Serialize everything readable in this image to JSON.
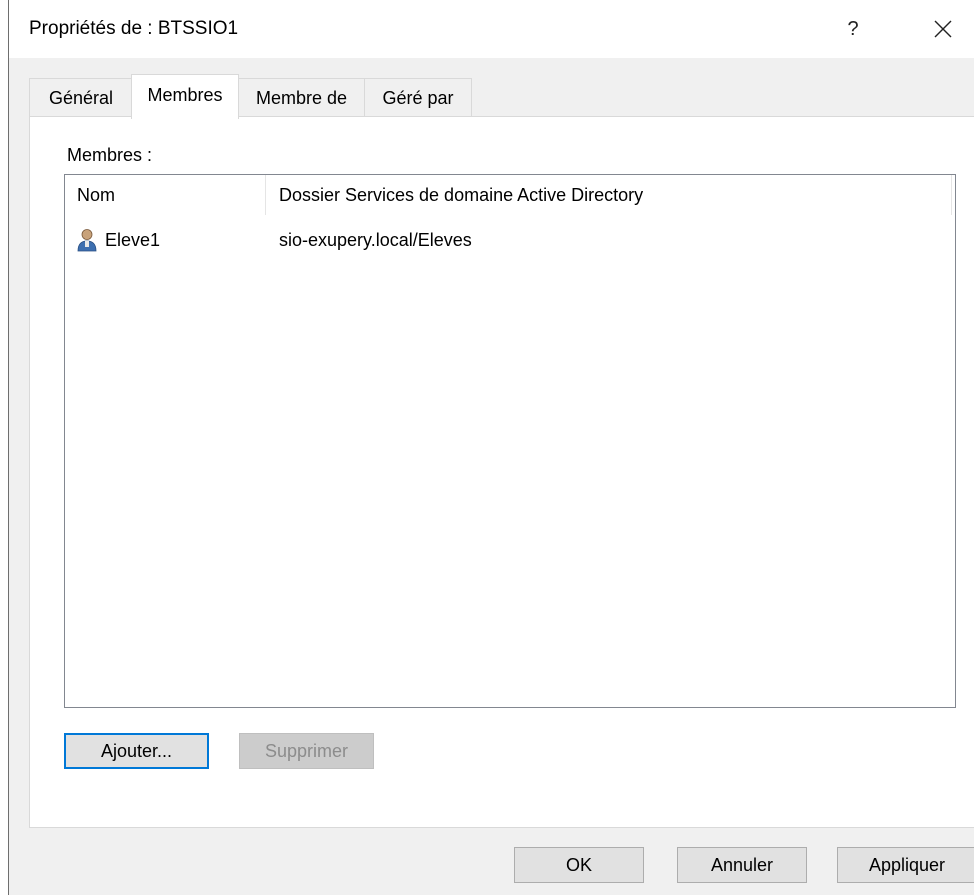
{
  "window": {
    "title": "Propriétés de : BTSSIO1",
    "help_label": "?"
  },
  "tabs": [
    {
      "label": "Général",
      "active": false
    },
    {
      "label": "Membres",
      "active": true
    },
    {
      "label": "Membre de",
      "active": false
    },
    {
      "label": "Géré par",
      "active": false
    }
  ],
  "members": {
    "label": "Membres :",
    "columns": [
      "Nom",
      "Dossier Services de domaine Active Directory"
    ],
    "rows": [
      {
        "name": "Eleve1",
        "folder": "sio-exupery.local/Eleves",
        "icon": "user-icon"
      }
    ],
    "add_label": "Ajouter...",
    "remove_label": "Supprimer"
  },
  "footer": {
    "ok_label": "OK",
    "cancel_label": "Annuler",
    "apply_label": "Appliquer"
  },
  "colors": {
    "focus_border": "#0078d7",
    "dialog_bg": "#f0f0f0"
  }
}
